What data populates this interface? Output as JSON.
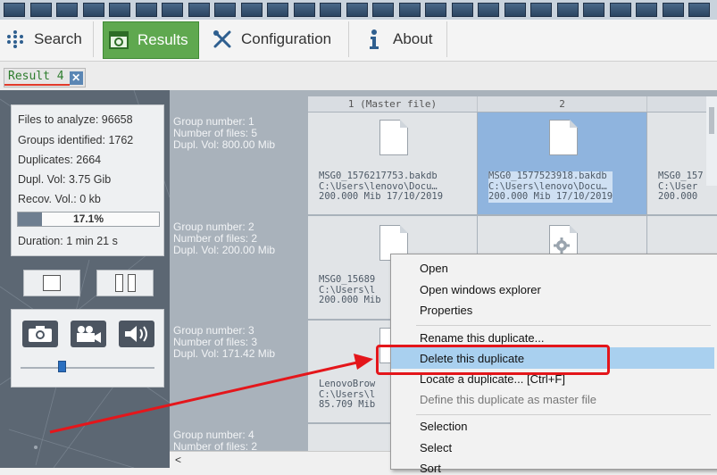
{
  "toolbar": {
    "items": [
      {
        "label": "Search",
        "icon": "dots-grid-icon",
        "active": false
      },
      {
        "label": "Results",
        "icon": "results-window-icon",
        "active": true
      },
      {
        "label": "Configuration",
        "icon": "wrench-screwdriver-icon",
        "active": false
      },
      {
        "label": "About",
        "icon": "info-icon",
        "active": false
      }
    ]
  },
  "result_tab": {
    "label": "Result 4",
    "close_glyph": "✕"
  },
  "stats": {
    "files_to_analyze": "Files to analyze: 96658",
    "groups_identified": "Groups identified: 1762",
    "duplicates": "Duplicates: 2664",
    "dupl_vol": "Dupl. Vol: 3.75 Gib",
    "recov_vol": "Recov. Vol.: 0 kb",
    "progress_percent": 17.1,
    "progress_label": "17.1%",
    "duration": "Duration: 1 min  21 s"
  },
  "controls": {
    "stop": "stop-icon",
    "pause": "pause-icon"
  },
  "media": {
    "camera": "camera-icon",
    "video": "video-camera-icon",
    "sound": "speaker-icon",
    "volume_level": 0.28
  },
  "grid": {
    "columns": [
      "1 (Master file)",
      "2",
      ""
    ],
    "groups": [
      {
        "info": [
          "Group number: 1",
          "Number of files: 5",
          "Dupl. Vol: 800.00 Mib"
        ],
        "files": [
          {
            "name": "MSG0_1576217753.bakdb",
            "path": "C:\\Users\\lenovo\\Docu…",
            "meta": "200.000 Mib 17/10/2019",
            "selected": false
          },
          {
            "name": "MSG0_1577523918.bakdb",
            "path": "C:\\Users\\lenovo\\Docu…",
            "meta": "200.000 Mib 17/10/2019",
            "selected": true
          },
          {
            "name": "MSG0_157",
            "path": "C:\\User",
            "meta": "200.000",
            "selected": false
          }
        ]
      },
      {
        "info": [
          "Group number: 2",
          "Number of files: 2",
          "Dupl. Vol: 200.00 Mib"
        ],
        "files": [
          {
            "name": "MSG0_15689",
            "path": "C:\\Users\\l",
            "meta": "200.000 Mib"
          }
        ]
      },
      {
        "info": [
          "Group number: 3",
          "Number of files: 3",
          "Dupl. Vol: 171.42 Mib"
        ],
        "files": [
          {
            "name": "LenovoBrow",
            "path": "C:\\Users\\l",
            "meta": "85.709 Mib"
          }
        ]
      },
      {
        "info": [
          "Group number: 4",
          "Number of files: 2",
          ""
        ],
        "files": []
      }
    ],
    "scroll_left_glyph": "<"
  },
  "context_menu": {
    "items": [
      {
        "label": "Open",
        "disabled": false
      },
      {
        "label": "Open windows explorer",
        "disabled": false
      },
      {
        "label": "Properties",
        "disabled": false
      },
      {
        "label": "Rename this duplicate...",
        "disabled": false
      },
      {
        "label": "Delete this duplicate",
        "disabled": false,
        "highlighted": true
      },
      {
        "label": "Locate a duplicate...  [Ctrl+F]",
        "disabled": false
      },
      {
        "label": "Define this duplicate as master file",
        "disabled": true
      },
      {
        "label": "Selection",
        "disabled": false
      },
      {
        "label": "Select",
        "disabled": false
      },
      {
        "label": "Sort",
        "disabled": false
      }
    ]
  },
  "colors": {
    "accent_green": "#5fa84f",
    "highlight": "#a9d0ef",
    "annotation_red": "#e4161b",
    "selection_blue": "#8fb4de"
  }
}
